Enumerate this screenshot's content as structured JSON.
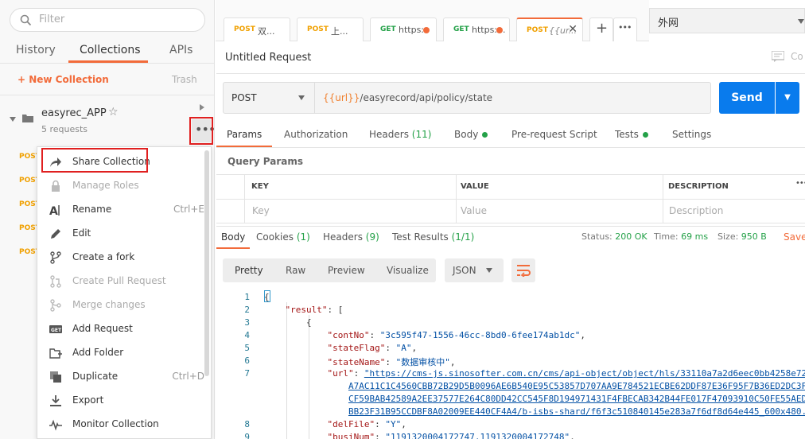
{
  "sidebar": {
    "filter_placeholder": "Filter",
    "tabs": [
      {
        "label": "History"
      },
      {
        "label": "Collections"
      },
      {
        "label": "APIs"
      }
    ],
    "new_collection": "+ New Collection",
    "trash": "Trash",
    "collection": {
      "name": "easyrec_APP",
      "requests": "5 requests"
    },
    "request_methods": [
      "POST",
      "POST",
      "POST",
      "POST",
      "POST"
    ]
  },
  "context_menu": [
    {
      "label": "Share Collection",
      "shortcut": "",
      "icon": "share-icon",
      "disabled": false
    },
    {
      "label": "Manage Roles",
      "shortcut": "",
      "icon": "lock-icon",
      "disabled": true
    },
    {
      "label": "Rename",
      "shortcut": "Ctrl+E",
      "icon": "rename-icon",
      "disabled": false
    },
    {
      "label": "Edit",
      "shortcut": "",
      "icon": "pencil-icon",
      "disabled": false
    },
    {
      "label": "Create a fork",
      "shortcut": "",
      "icon": "fork-icon",
      "disabled": false
    },
    {
      "label": "Create Pull Request",
      "shortcut": "",
      "icon": "pull-request-icon",
      "disabled": true
    },
    {
      "label": "Merge changes",
      "shortcut": "",
      "icon": "merge-icon",
      "disabled": true
    },
    {
      "label": "Add Request",
      "shortcut": "",
      "icon": "get-request-icon",
      "disabled": false
    },
    {
      "label": "Add Folder",
      "shortcut": "",
      "icon": "add-folder-icon",
      "disabled": false
    },
    {
      "label": "Duplicate",
      "shortcut": "Ctrl+D",
      "icon": "duplicate-icon",
      "disabled": false
    },
    {
      "label": "Export",
      "shortcut": "",
      "icon": "export-icon",
      "disabled": false
    },
    {
      "label": "Monitor Collection",
      "shortcut": "",
      "icon": "monitor-icon",
      "disabled": false
    }
  ],
  "tabs": [
    {
      "method": "POST",
      "name": "双...",
      "unsaved": false
    },
    {
      "method": "POST",
      "name": "上...",
      "unsaved": false
    },
    {
      "method": "GET",
      "name": "https:",
      "unsaved": true
    },
    {
      "method": "GET",
      "name": "https:...",
      "unsaved": true
    },
    {
      "method": "POST",
      "name": "{{ur...",
      "unsaved": false
    }
  ],
  "environment": "外网",
  "request": {
    "title": "Untitled Request",
    "comments": "Co",
    "method": "POST",
    "url_var": "{{url}}",
    "url_path": "/easyrecord/api/policy/state",
    "send": "Send"
  },
  "param_tabs": {
    "params": "Params",
    "authorization": "Authorization",
    "headers": "Headers",
    "headers_count": "(11)",
    "body": "Body",
    "prerequest": "Pre-request Script",
    "tests": "Tests",
    "settings": "Settings"
  },
  "query_params": {
    "title": "Query Params",
    "columns": [
      "KEY",
      "VALUE",
      "DESCRIPTION"
    ],
    "placeholders": [
      "Key",
      "Value",
      "Description"
    ]
  },
  "response": {
    "tabs": {
      "body": "Body",
      "cookies": "Cookies",
      "cookies_count": "(1)",
      "headers": "Headers",
      "headers_count": "(9)",
      "test_results": "Test Results",
      "test_count": "(1/1)"
    },
    "status_label": "Status:",
    "status": "200 OK",
    "time_label": "Time:",
    "time": "69 ms",
    "size_label": "Size:",
    "size": "950 B",
    "save": "Save",
    "views": [
      "Pretty",
      "Raw",
      "Preview",
      "Visualize"
    ],
    "format": "JSON"
  },
  "code_lines": [
    {
      "n": "1",
      "text": "{"
    },
    {
      "n": "2",
      "text": "    \"result\": ["
    },
    {
      "n": "3",
      "text": "        {"
    },
    {
      "n": "4",
      "text": "            \"contNo\": \"3c595f47-1556-46cc-8bd0-6fee174ab1dc\","
    },
    {
      "n": "5",
      "text": "            \"stateFlag\": \"A\","
    },
    {
      "n": "6",
      "text": "            \"stateName\": \"数据审核中\","
    },
    {
      "n": "7",
      "text": "            \"url\": \"https://cms-js.sinosofter.com.cn/cms/api-object/object/hls/33110a7a2d6eec0bb4258e72"
    },
    {
      "n": "",
      "text": "                A7AC11C1C4560CBB72B29D5B0096AE6B540E95C53857D707AA9E784521ECBE62DDF87E36F95F7B36ED2DC3F"
    },
    {
      "n": "",
      "text": "                CF59BAB42589A2EE37577E264C80DD42CC545F8D194971431F4FBECAB342B44FE017F47093910C50FE55AED"
    },
    {
      "n": "",
      "text": "                BB23F31B95CCDBF8A02009EE440CF4A4/b-isbs-shard/f6f3c510840145e283a7f6df8d64e445_600x480."
    },
    {
      "n": "8",
      "text": "            \"delFile\": \"Y\","
    },
    {
      "n": "9",
      "text": "            \"busiNum\": \"1191320004172747,1191320004172748\","
    }
  ]
}
